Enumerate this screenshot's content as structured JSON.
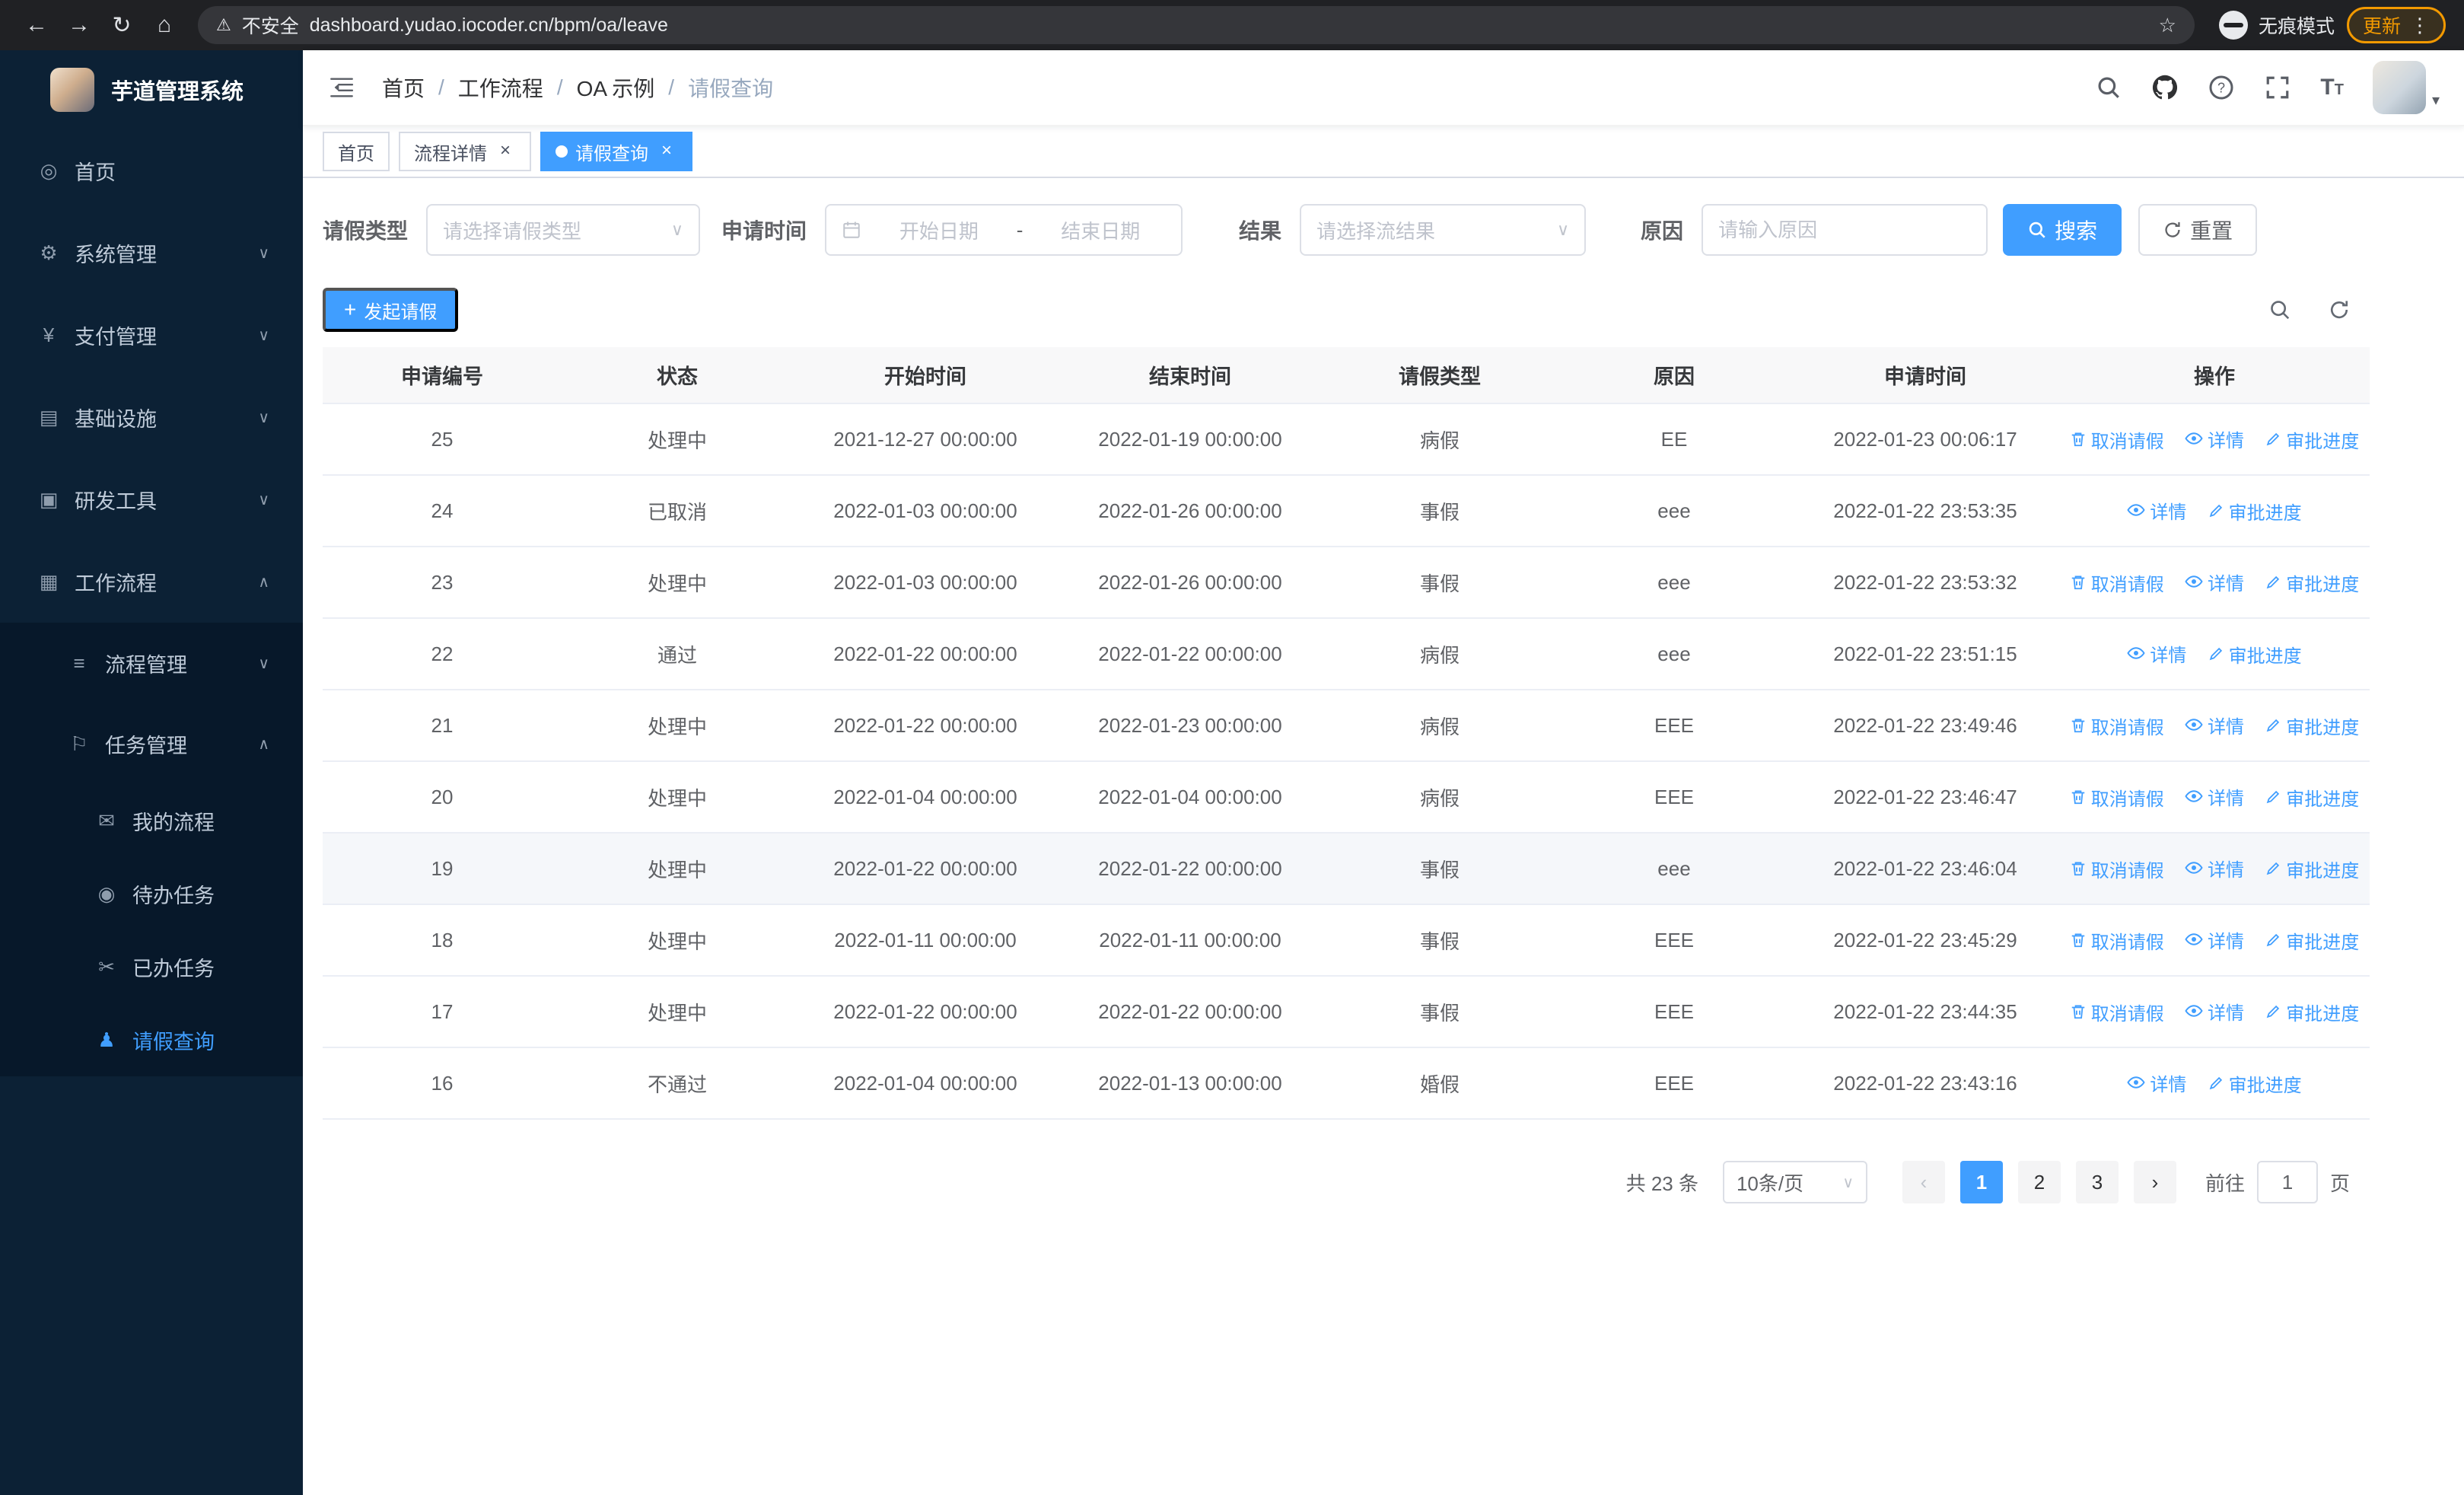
{
  "browser": {
    "security_label": "不安全",
    "url": "dashboard.yudao.iocoder.cn/bpm/oa/leave",
    "incognito_label": "无痕模式",
    "update_label": "更新"
  },
  "icons": {
    "back": "←",
    "forward": "→",
    "reload": "↻",
    "home": "⌂",
    "warning": "⚠",
    "star": "☆",
    "more": "⋮",
    "caret_down": "∨",
    "caret_up": "∧",
    "plus": "+",
    "dashboard": "◎",
    "gear": "⚙",
    "yen": "¥",
    "infra": "▤",
    "tools": "▣",
    "workflow": "▦",
    "process": "≡",
    "task": "⚐",
    "chat": "✉",
    "eye": "◉",
    "done": "✂",
    "user": "♟",
    "avatar_caret": "▾",
    "range_dash": "-"
  },
  "sidebar": {
    "app_title": "芋道管理系统",
    "items": [
      {
        "label": "首页"
      },
      {
        "label": "系统管理"
      },
      {
        "label": "支付管理"
      },
      {
        "label": "基础设施"
      },
      {
        "label": "研发工具"
      },
      {
        "label": "工作流程"
      },
      {
        "label": "流程管理"
      },
      {
        "label": "任务管理"
      },
      {
        "label": "我的流程"
      },
      {
        "label": "待办任务"
      },
      {
        "label": "已办任务"
      },
      {
        "label": "请假查询"
      }
    ]
  },
  "header": {
    "breadcrumb": [
      "首页",
      "工作流程",
      "OA 示例",
      "请假查询"
    ],
    "separator": "/"
  },
  "tabs": {
    "close_glyph": "×",
    "items": [
      {
        "label": "首页"
      },
      {
        "label": "流程详情"
      },
      {
        "label": "请假查询"
      }
    ]
  },
  "filters": {
    "type_label": "请假类型",
    "type_placeholder": "请选择请假类型",
    "time_label": "申请时间",
    "start_placeholder": "开始日期",
    "range_separator": "-",
    "end_placeholder": "结束日期",
    "result_label": "结果",
    "result_placeholder": "请选择流结果",
    "reason_label": "原因",
    "reason_placeholder": "请输入原因",
    "search_label": "搜索",
    "reset_label": "重置"
  },
  "toolbar": {
    "create_label": "发起请假"
  },
  "table": {
    "columns": [
      "申请编号",
      "状态",
      "开始时间",
      "结束时间",
      "请假类型",
      "原因",
      "申请时间",
      "操作"
    ],
    "action_labels": {
      "cancel": "取消请假",
      "detail": "详情",
      "progress": "审批进度"
    },
    "rows": [
      {
        "id": "25",
        "status": "处理中",
        "start": "2021-12-27 00:00:00",
        "end": "2022-01-19 00:00:00",
        "type": "病假",
        "reason": "EE",
        "applied": "2022-01-23 00:06:17",
        "can_cancel": true,
        "hover": false
      },
      {
        "id": "24",
        "status": "已取消",
        "start": "2022-01-03 00:00:00",
        "end": "2022-01-26 00:00:00",
        "type": "事假",
        "reason": "eee",
        "applied": "2022-01-22 23:53:35",
        "can_cancel": false,
        "hover": false
      },
      {
        "id": "23",
        "status": "处理中",
        "start": "2022-01-03 00:00:00",
        "end": "2022-01-26 00:00:00",
        "type": "事假",
        "reason": "eee",
        "applied": "2022-01-22 23:53:32",
        "can_cancel": true,
        "hover": false
      },
      {
        "id": "22",
        "status": "通过",
        "start": "2022-01-22 00:00:00",
        "end": "2022-01-22 00:00:00",
        "type": "病假",
        "reason": "eee",
        "applied": "2022-01-22 23:51:15",
        "can_cancel": false,
        "hover": false
      },
      {
        "id": "21",
        "status": "处理中",
        "start": "2022-01-22 00:00:00",
        "end": "2022-01-23 00:00:00",
        "type": "病假",
        "reason": "EEE",
        "applied": "2022-01-22 23:49:46",
        "can_cancel": true,
        "hover": false
      },
      {
        "id": "20",
        "status": "处理中",
        "start": "2022-01-04 00:00:00",
        "end": "2022-01-04 00:00:00",
        "type": "病假",
        "reason": "EEE",
        "applied": "2022-01-22 23:46:47",
        "can_cancel": true,
        "hover": false
      },
      {
        "id": "19",
        "status": "处理中",
        "start": "2022-01-22 00:00:00",
        "end": "2022-01-22 00:00:00",
        "type": "事假",
        "reason": "eee",
        "applied": "2022-01-22 23:46:04",
        "can_cancel": true,
        "hover": true
      },
      {
        "id": "18",
        "status": "处理中",
        "start": "2022-01-11 00:00:00",
        "end": "2022-01-11 00:00:00",
        "type": "事假",
        "reason": "EEE",
        "applied": "2022-01-22 23:45:29",
        "can_cancel": true,
        "hover": false
      },
      {
        "id": "17",
        "status": "处理中",
        "start": "2022-01-22 00:00:00",
        "end": "2022-01-22 00:00:00",
        "type": "事假",
        "reason": "EEE",
        "applied": "2022-01-22 23:44:35",
        "can_cancel": true,
        "hover": false
      },
      {
        "id": "16",
        "status": "不通过",
        "start": "2022-01-04 00:00:00",
        "end": "2022-01-13 00:00:00",
        "type": "婚假",
        "reason": "EEE",
        "applied": "2022-01-22 23:43:16",
        "can_cancel": false,
        "hover": false
      }
    ]
  },
  "pagination": {
    "total_label": "共 23 条",
    "page_size": "10条/页",
    "prev_glyph": "‹",
    "next_glyph": "›",
    "pages": [
      "1",
      "2",
      "3"
    ],
    "goto_label": "前往",
    "goto_value": "1",
    "goto_suffix": "页"
  }
}
